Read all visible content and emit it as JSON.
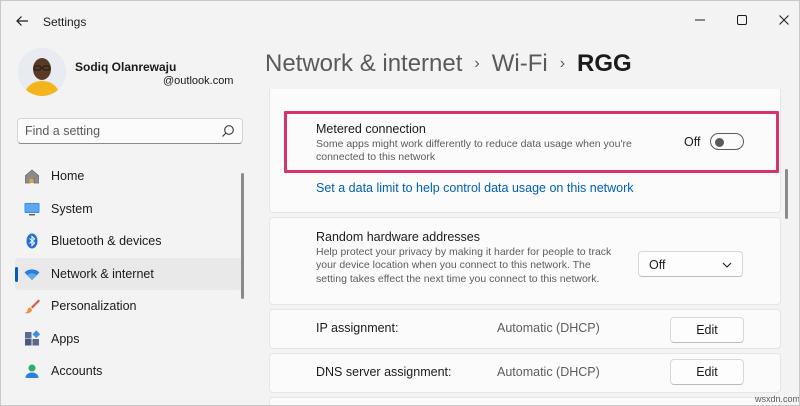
{
  "window": {
    "title": "Settings"
  },
  "profile": {
    "name": "Sodiq Olanrewaju",
    "email": "@outlook.com"
  },
  "search": {
    "placeholder": "Find a setting"
  },
  "sidebar": {
    "items": [
      {
        "label": "Home",
        "icon": "home-icon",
        "active": false
      },
      {
        "label": "System",
        "icon": "monitor-icon",
        "active": false
      },
      {
        "label": "Bluetooth & devices",
        "icon": "bluetooth-icon",
        "active": false
      },
      {
        "label": "Network & internet",
        "icon": "wifi-icon",
        "active": true
      },
      {
        "label": "Personalization",
        "icon": "brush-icon",
        "active": false
      },
      {
        "label": "Apps",
        "icon": "apps-icon",
        "active": false
      },
      {
        "label": "Accounts",
        "icon": "person-icon",
        "active": false
      }
    ]
  },
  "breadcrumb": {
    "items": [
      "Network & internet",
      "Wi-Fi",
      "RGG"
    ],
    "separator": "›"
  },
  "metered": {
    "title": "Metered connection",
    "description": "Some apps might work differently to reduce data usage when you're connected to this network",
    "state_label": "Off",
    "enabled": false,
    "link": "Set a data limit to help control data usage on this network"
  },
  "random_hw": {
    "title": "Random hardware addresses",
    "description": "Help protect your privacy by making it harder for people to track your device location when you connect to this network. The setting takes effect the next time you connect to this network.",
    "selected": "Off"
  },
  "ip_assignment": {
    "label": "IP assignment:",
    "value": "Automatic (DHCP)",
    "button": "Edit"
  },
  "dns_assignment": {
    "label": "DNS server assignment:",
    "value": "Automatic (DHCP)",
    "button": "Edit"
  },
  "watermark": "wsxdn.com",
  "colors": {
    "accent": "#005fb8",
    "highlight": "#d6336c",
    "background": "#f3f3f3",
    "card": "#fbfbfb"
  }
}
